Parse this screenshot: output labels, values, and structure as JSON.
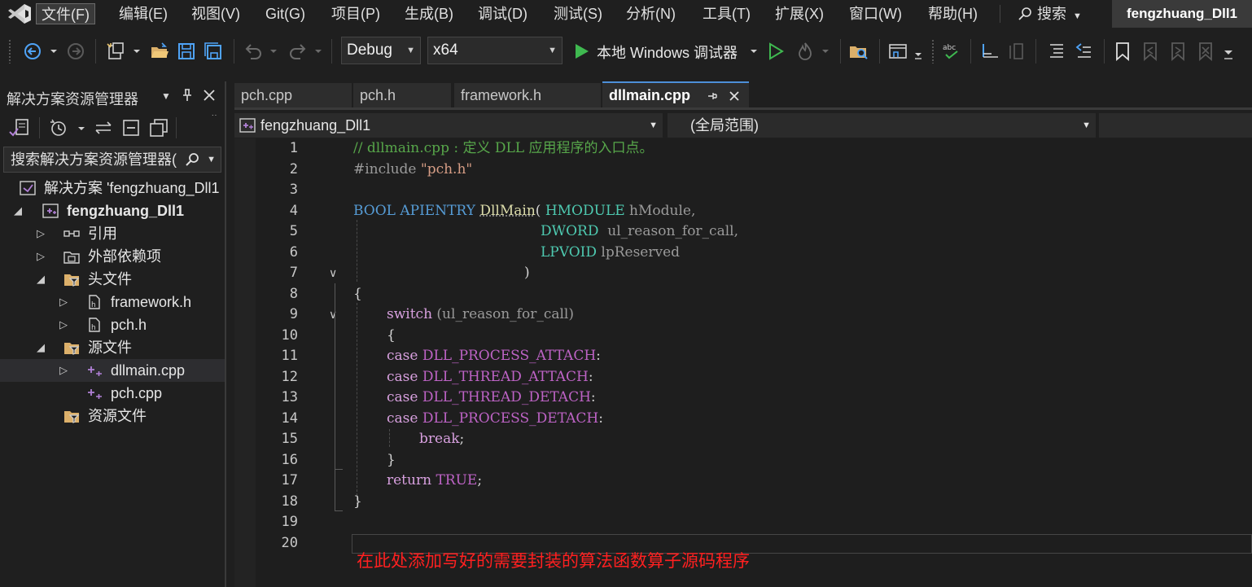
{
  "menubar": {
    "items": [
      "文件(F)",
      "编辑(E)",
      "视图(V)",
      "Git(G)",
      "项目(P)",
      "生成(B)",
      "调试(D)",
      "测试(S)",
      "分析(N)",
      "工具(T)",
      "扩展(X)",
      "窗口(W)",
      "帮助(H)"
    ],
    "search_label": "搜索",
    "project_name": "fengzhuang_Dll1"
  },
  "toolbar": {
    "configuration": "Debug",
    "platform": "x64",
    "debugger_label": "本地 Windows 调试器"
  },
  "solution_explorer": {
    "title": "解决方案资源管理器",
    "search_placeholder": "搜索解决方案资源管理器(",
    "tree": [
      {
        "label": "解决方案 'fengzhuang_Dll1"
      },
      {
        "label": "fengzhuang_Dll1"
      },
      {
        "label": "引用"
      },
      {
        "label": "外部依赖项"
      },
      {
        "label": "头文件"
      },
      {
        "label": "framework.h"
      },
      {
        "label": "pch.h"
      },
      {
        "label": "源文件"
      },
      {
        "label": "dllmain.cpp"
      },
      {
        "label": "pch.cpp"
      },
      {
        "label": "资源文件"
      }
    ]
  },
  "tabs": [
    {
      "label": "pch.cpp"
    },
    {
      "label": "pch.h"
    },
    {
      "label": "framework.h"
    },
    {
      "label": "dllmain.cpp"
    }
  ],
  "navbar": {
    "project": "fengzhuang_Dll1",
    "scope": "(全局范围)"
  },
  "editor": {
    "line_numbers": [
      "1",
      "2",
      "3",
      "4",
      "5",
      "6",
      "7",
      "8",
      "9",
      "10",
      "11",
      "12",
      "13",
      "14",
      "15",
      "16",
      "17",
      "18",
      "19",
      "20"
    ],
    "code": {
      "l1": "// dllmain.cpp : 定义 DLL 应用程序的入口点。",
      "l2_pre": "#include ",
      "l2_str": "\"pch.h\"",
      "l4_kw": "BOOL APIENTRY ",
      "l4_fn": "DllMain",
      "l4_p": "( ",
      "l4_type": "HMODULE",
      "l4_param": " hModule,",
      "l5_type": "DWORD",
      "l5_param": "  ul_reason_for_call,",
      "l6_type": "LPVOID",
      "l6_param": " lpReserved",
      "l7": ")",
      "l8": "{",
      "l9_kw": "switch",
      "l9_rest": " (ul_reason_for_call)",
      "l10": "{",
      "l11_kw": "case",
      "l11_m": " DLL_PROCESS_ATTACH",
      "l11_p": ":",
      "l12_kw": "case",
      "l12_m": " DLL_THREAD_ATTACH",
      "l12_p": ":",
      "l13_kw": "case",
      "l13_m": " DLL_THREAD_DETACH",
      "l13_p": ":",
      "l14_kw": "case",
      "l14_m": " DLL_PROCESS_DETACH",
      "l14_p": ":",
      "l15_kw": "break",
      "l15_p": ";",
      "l16": "}",
      "l17_kw": "return",
      "l17_m": " TRUE",
      "l17_p": ";",
      "l18": "}"
    },
    "annotation": "在此处添加写好的需要封装的算法函数算子源码程序"
  }
}
